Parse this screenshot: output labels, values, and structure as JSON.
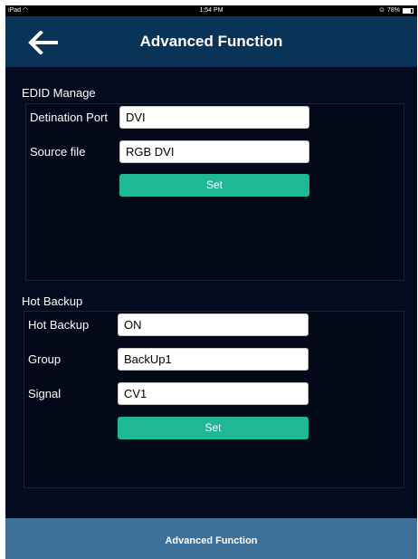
{
  "status_bar": {
    "device": "iPad",
    "time": "1:54 PM",
    "battery_text": "78%",
    "battery_level": 0.78
  },
  "header": {
    "title": "Advanced Function",
    "back_icon": "arrow-left-icon"
  },
  "edid": {
    "section_title": "EDID Manage",
    "fields": [
      {
        "label": "Detination Port",
        "value": "DVI"
      },
      {
        "label": "Source file",
        "value": "RGB DVI"
      }
    ],
    "set_label": "Set"
  },
  "hot_backup": {
    "section_title": "Hot Backup",
    "fields": [
      {
        "label": "Hot Backup",
        "value": "ON"
      },
      {
        "label": "Group",
        "value": "BackUp1"
      },
      {
        "label": "Signal",
        "value": "CV1"
      }
    ],
    "set_label": "Set"
  },
  "tab_bar": {
    "label": "Advanced Function"
  },
  "colors": {
    "background": "#040b1e",
    "navbar": "#0a3358",
    "accent_button": "#1fb897",
    "tab_bar": "#3e6f96"
  }
}
